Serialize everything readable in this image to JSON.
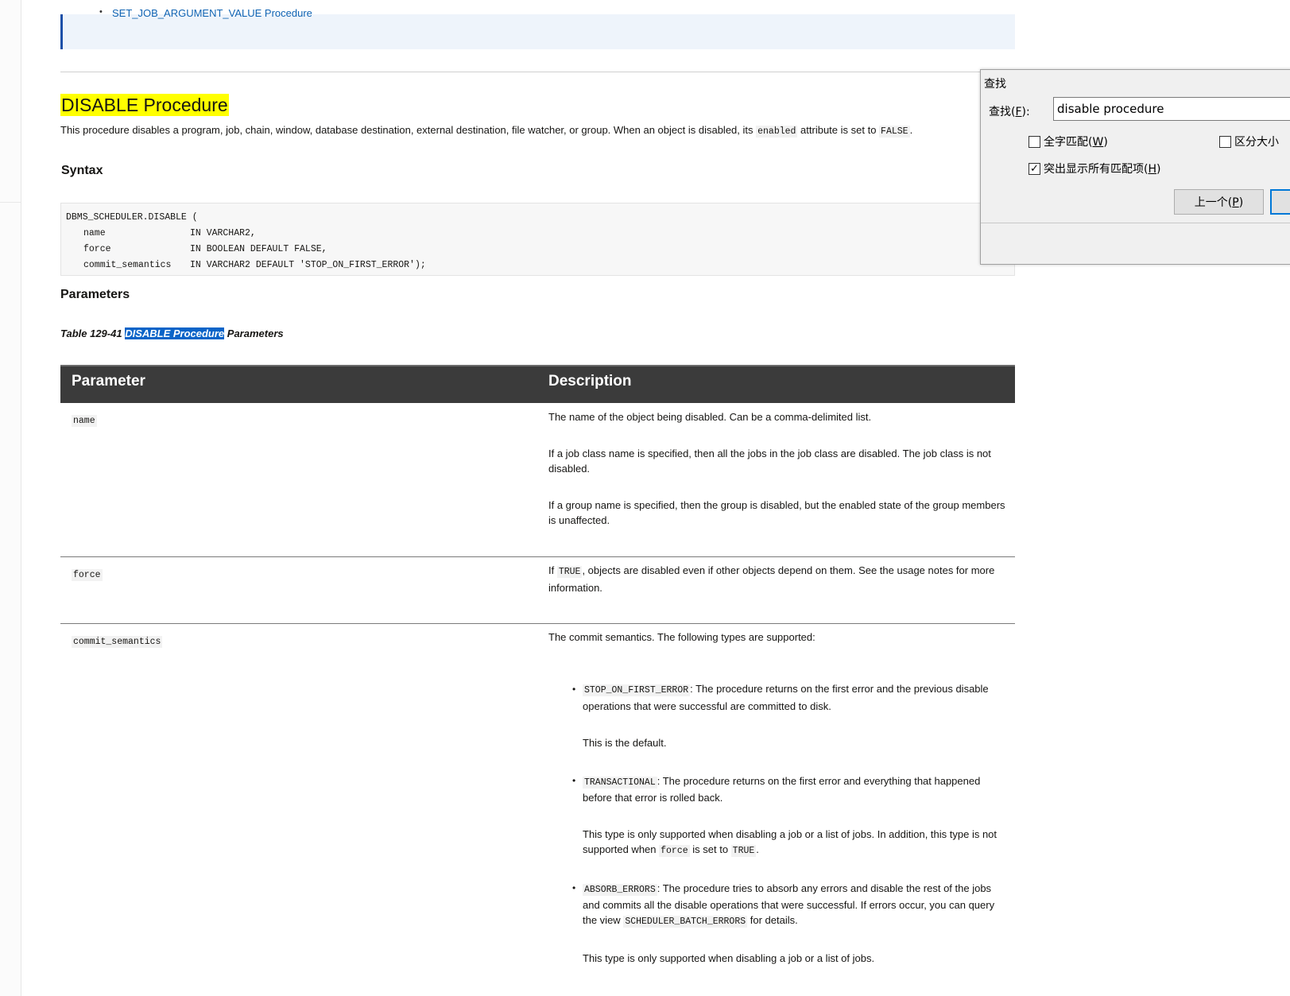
{
  "related": {
    "item": "SET_JOB_ARGUMENT_VALUE Procedure"
  },
  "section": {
    "title": "DISABLE Procedure",
    "intro_1": "This procedure disables a program, job, chain, window, database destination, external destination, file watcher, or group. When an object is disabled, its ",
    "intro_code_1": "enabled",
    "intro_2": " attribute is set to ",
    "intro_code_2": "FALSE",
    "intro_3": "."
  },
  "syntax": {
    "heading": "Syntax",
    "code_line_1": "DBMS_SCHEDULER.DISABLE (",
    "params": [
      {
        "name": "name",
        "spec": "IN VARCHAR2,"
      },
      {
        "name": "force",
        "spec": "IN BOOLEAN DEFAULT FALSE,"
      },
      {
        "name": "commit_semantics",
        "spec": "IN VARCHAR2 DEFAULT 'STOP_ON_FIRST_ERROR');"
      }
    ]
  },
  "parameters": {
    "heading": "Parameters",
    "caption_prefix": "Table 129-41 ",
    "caption_highlight": "DISABLE Procedure",
    "caption_suffix": " Parameters",
    "columns": [
      "Parameter",
      "Description"
    ],
    "rows": {
      "name": {
        "param": "name",
        "desc_1": "The name of the object being disabled. Can be a comma-delimited list.",
        "desc_2": "If a job class name is specified, then all the jobs in the job class are disabled. The job class is not disabled.",
        "desc_3": "If a group name is specified, then the group is disabled, but the enabled state of the group members is unaffected."
      },
      "force": {
        "param": "force",
        "desc_a": "If ",
        "desc_code": "TRUE",
        "desc_b": ", objects are disabled even if other objects depend on them. See the usage notes for more information."
      },
      "commit": {
        "param": "commit_semantics",
        "desc_intro": "The commit semantics. The following types are supported:",
        "bullets": [
          {
            "code": "STOP_ON_FIRST_ERROR",
            "text": ": The procedure returns on the first error and the previous disable operations that were successful are committed to disk.",
            "note": "This is the default."
          },
          {
            "code": "TRANSACTIONAL",
            "text": ": The procedure returns on the first error and everything that happened before that error is rolled back.",
            "note_a": "This type is only supported when disabling a job or a list of jobs. In addition, this type is not supported when ",
            "note_code_1": "force",
            "note_b": " is set to ",
            "note_code_2": "TRUE",
            "note_c": "."
          },
          {
            "code": "ABSORB_ERRORS",
            "text_a": ": The procedure tries to absorb any errors and disable the rest of the jobs and commits all the disable operations that were successful. If errors occur, you can query the view ",
            "text_code": "SCHEDULER_BATCH_ERRORS",
            "text_b": " for details.",
            "note": "This type is only supported when disabling a job or a list of jobs."
          }
        ]
      }
    }
  },
  "find_dialog": {
    "title": "查找",
    "label_main": "查找(",
    "label_key": "F",
    "label_end": "):",
    "input_value": "disable procedure",
    "whole_word": {
      "main": "全字匹配(",
      "key": "W",
      "end": ")",
      "checked": false
    },
    "match_case": {
      "main": "区分大小",
      "checked": false
    },
    "highlight_all": {
      "main": "突出显示所有匹配项(",
      "key": "H",
      "end": ")",
      "checked": true,
      "mark": "✓"
    },
    "prev_button": {
      "main": "上一个(",
      "key": "P",
      "end": ")"
    }
  }
}
